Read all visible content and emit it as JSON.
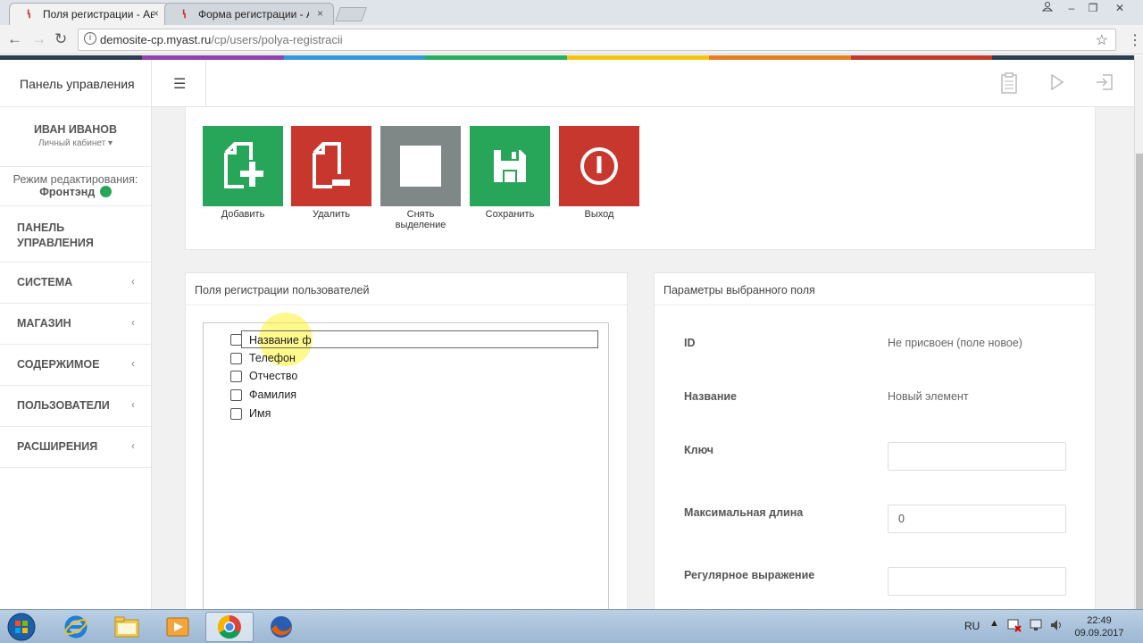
{
  "browser": {
    "tabs": [
      {
        "title": "Поля регистрации - Ав",
        "close": "×"
      },
      {
        "title": "Форма регистрации - А",
        "close": "×"
      }
    ],
    "url_host": "demosite-cp.myast.ru",
    "url_path": "/cp/users/polya-registracii"
  },
  "stripe_colors": [
    "#2c3e50",
    "#8e44ad",
    "#3498db",
    "#27ae60",
    "#f1c40f",
    "#e67e22",
    "#c0392b",
    "#2c3e50"
  ],
  "sidebar": {
    "brand": "Панель управления",
    "user_name": "ИВАН ИВАНОВ",
    "user_cabinet": "Личный кабинет ▾",
    "edit_mode_label": "Режим редактирования:",
    "edit_mode_value": "Фронтэнд",
    "items": [
      {
        "label": "ПАНЕЛЬ\nУПРАВЛЕНИЯ",
        "chevron": ""
      },
      {
        "label": "СИСТЕМА",
        "chevron": "‹"
      },
      {
        "label": "МАГАЗИН",
        "chevron": "‹"
      },
      {
        "label": "СОДЕРЖИМОЕ",
        "chevron": "‹"
      },
      {
        "label": "ПОЛЬЗОВАТЕЛИ",
        "chevron": "‹"
      },
      {
        "label": "РАСШИРЕНИЯ",
        "chevron": "‹"
      }
    ]
  },
  "toolbar": {
    "add": "Добавить",
    "delete": "Удалить",
    "deselect_1": "Снять",
    "deselect_2": "выделение",
    "save": "Сохранить",
    "exit": "Выход"
  },
  "colors": {
    "green": "#27a65a",
    "red": "#c8372d",
    "gray": "#7f8886"
  },
  "fields_panel": {
    "title": "Поля регистрации пользователей",
    "editing_value": "Название ф",
    "items": [
      "Телефон",
      "Отчество",
      "Фамилия",
      "Имя"
    ]
  },
  "params_panel": {
    "title": "Параметры выбранного поля",
    "id_label": "ID",
    "id_value": "Не присвоен (поле новое)",
    "name_label": "Название",
    "name_value": "Новый элемент",
    "key_label": "Ключ",
    "key_value": "",
    "maxlen_label": "Максимальная длина",
    "maxlen_value": "0",
    "regex_label": "Регулярное выражение",
    "regex_value": ""
  },
  "taskbar": {
    "lang": "RU",
    "time": "22:49",
    "date": "09.09.2017"
  }
}
